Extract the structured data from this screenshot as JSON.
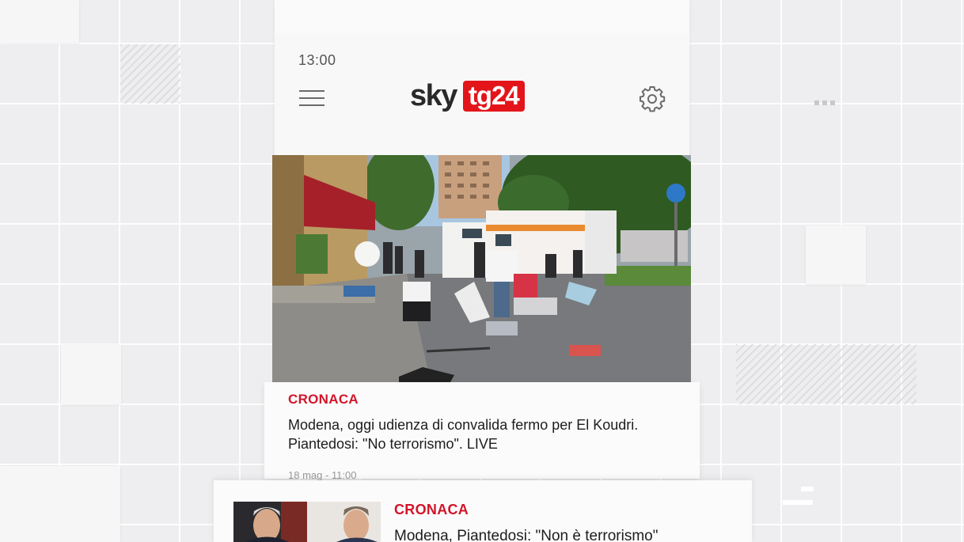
{
  "status_bar": {
    "time": "13:00"
  },
  "header": {
    "logo_brand": "sky",
    "logo_channel": "tg24",
    "menu_icon": "hamburger-menu-icon",
    "settings_icon": "gear-icon"
  },
  "featured": {
    "category": "CRONACA",
    "headline_line1": "Modena, oggi udienza di convalida fermo per El Koudri.",
    "headline_line2": "Piantedosi: \"No terrorismo\". LIVE",
    "timestamp": "18 mag - 11:00"
  },
  "second_article": {
    "category": "CRONACA",
    "headline": "Modena, Piantedosi: \"Non è terrorismo\""
  },
  "colors": {
    "accent_red": "#e3151b",
    "category_red": "#d2152a",
    "background": "#eeeef0"
  }
}
